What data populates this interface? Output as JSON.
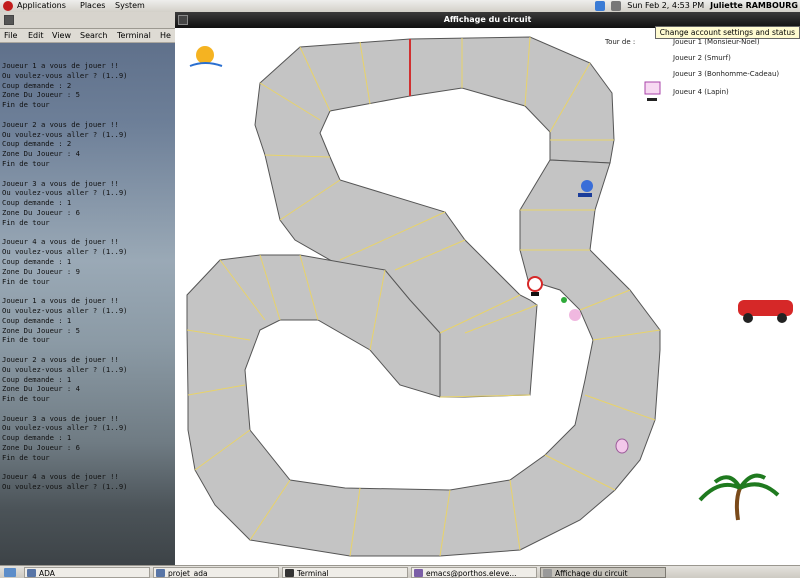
{
  "top_panel": {
    "menus": [
      "Applications",
      "Places",
      "System"
    ],
    "clock": "Sun Feb 2, 4:53 PM",
    "user": "Juliette RAMBOURG"
  },
  "terminal": {
    "menus": [
      "File",
      "Edit",
      "View",
      "Search",
      "Terminal",
      "He"
    ],
    "lines": [
      "Joueur 1 a vous de jouer !!",
      "Ou voulez-vous aller ? (1..9)",
      "Coup demande : 2",
      "Zone Du Joueur : 5",
      "Fin de tour",
      "",
      "Joueur 2 a vous de jouer !!",
      "Ou voulez-vous aller ? (1..9)",
      "Coup demande : 2",
      "Zone Du Joueur : 4",
      "Fin de tour",
      "",
      "Joueur 3 a vous de jouer !!",
      "Ou voulez-vous aller ? (1..9)",
      "Coup demande : 1",
      "Zone Du Joueur : 6",
      "Fin de tour",
      "",
      "Joueur 4 a vous de jouer !!",
      "Ou voulez-vous aller ? (1..9)",
      "Coup demande : 1",
      "Zone Du Joueur : 9",
      "Fin de tour",
      "",
      "Joueur 1 a vous de jouer !!",
      "Ou voulez-vous aller ? (1..9)",
      "Coup demande : 1",
      "Zone Du Joueur : 5",
      "Fin de tour",
      "",
      "Joueur 2 a vous de jouer !!",
      "Ou voulez-vous aller ? (1..9)",
      "Coup demande : 1",
      "Zone Du Joueur : 4",
      "Fin de tour",
      "",
      "Joueur 3 a vous de jouer !!",
      "Ou voulez-vous aller ? (1..9)",
      "Coup demande : 1",
      "Zone Du Joueur : 6",
      "Fin de tour",
      "",
      "Joueur 4 a vous de jouer !!",
      "Ou voulez-vous aller ? (1..9)"
    ]
  },
  "game_window": {
    "title": "Affichage du circuit",
    "tooltip": "Change account settings and status",
    "turn_label": "Tour de :",
    "players": [
      "Joueur 1 (Monsieur-Noel)",
      "Joueur 2 (Smurf)",
      "Joueur 3 (Bonhomme-Cadeau)",
      "Joueur 4 (Lapin)"
    ],
    "colors": {
      "track_fill": "#c4c4c4",
      "track_stroke": "#555555",
      "section_line": "#e8d36a",
      "finish_line": "#d03030"
    }
  },
  "taskbar": {
    "items": [
      "ADA",
      "projet_ada",
      "Terminal",
      "emacs@porthos.eleve...",
      "Affichage du circuit"
    ]
  }
}
